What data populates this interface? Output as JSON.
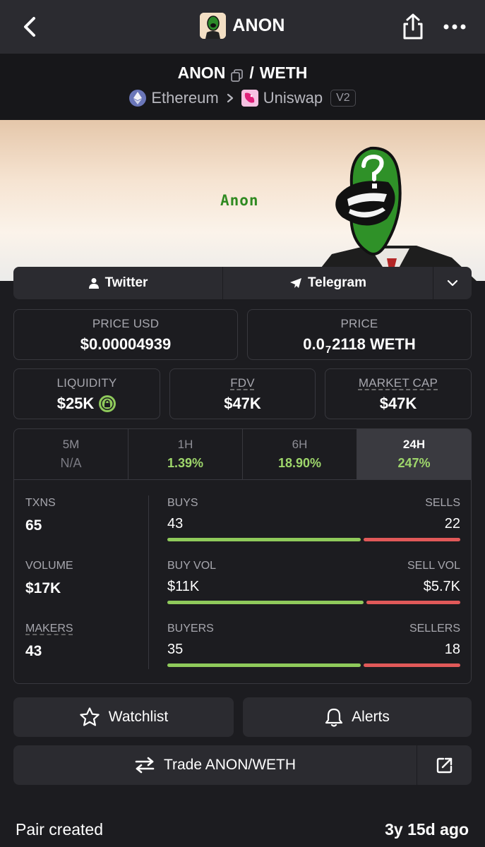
{
  "header": {
    "title": "ANON",
    "avatar_icon": "pepe-avatar",
    "back_icon": "chevron-left",
    "share_icon": "share-icon",
    "more_icon": "ellipsis-icon"
  },
  "pair": {
    "base": "ANON",
    "separator": "/",
    "quote": "WETH",
    "chain": "Ethereum",
    "dex": "Uniswap",
    "version": "V2"
  },
  "banner": {
    "word": "Anon"
  },
  "social": {
    "twitter": "Twitter",
    "telegram": "Telegram"
  },
  "cards": {
    "price_usd": {
      "label": "PRICE USD",
      "value": "$0.00004939"
    },
    "price": {
      "label": "PRICE",
      "value_prefix": "0.0",
      "value_sub": "7",
      "value_suffix": "2118 WETH"
    },
    "liquidity": {
      "label": "LIQUIDITY",
      "value": "$25K"
    },
    "fdv": {
      "label": "FDV",
      "value": "$47K"
    },
    "market_cap": {
      "label": "MARKET CAP",
      "value": "$47K"
    }
  },
  "tabs": [
    {
      "label": "5M",
      "value": "N/A"
    },
    {
      "label": "1H",
      "value": "1.39%"
    },
    {
      "label": "6H",
      "value": "18.90%"
    },
    {
      "label": "24H",
      "value": "247%"
    }
  ],
  "metrics": {
    "txns": {
      "label": "TXNS",
      "value": "65"
    },
    "volume": {
      "label": "VOLUME",
      "value": "$17K"
    },
    "makers": {
      "label": "MAKERS",
      "value": "43"
    },
    "buys": {
      "label": "BUYS",
      "value": "43",
      "other_label": "SELLS",
      "other_value": "22",
      "ratio": 0.66
    },
    "vol": {
      "label": "BUY VOL",
      "value": "$11K",
      "other_label": "SELL VOL",
      "other_value": "$5.7K",
      "ratio": 0.67
    },
    "buyers": {
      "label": "BUYERS",
      "value": "35",
      "other_label": "SELLERS",
      "other_value": "18",
      "ratio": 0.66
    }
  },
  "actions": {
    "watchlist": "Watchlist",
    "alerts": "Alerts",
    "trade": "Trade ANON/WETH"
  },
  "footer": {
    "label": "Pair created",
    "value": "3y 15d ago"
  },
  "colors": {
    "accent_green": "#9ed66b",
    "bar_green": "#8fca5b",
    "bar_red": "#e15959",
    "background": "#1c1c20",
    "surface": "#2b2b30"
  }
}
